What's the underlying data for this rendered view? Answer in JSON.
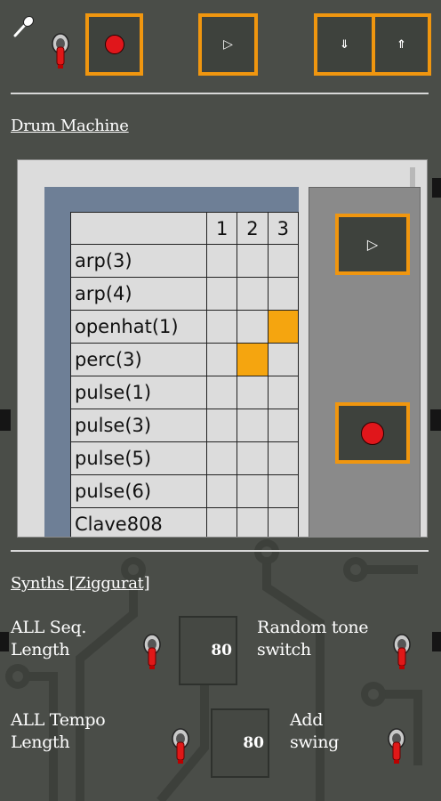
{
  "toolbar": {
    "icons": [
      "mic-icon",
      "toggle-switch-icon",
      "record-icon",
      "play-icon",
      "arrow-down-icon",
      "arrow-up-icon"
    ],
    "play_glyph": "▷",
    "down_glyph": "⇓",
    "up_glyph": "⇑"
  },
  "drum_machine": {
    "title": "Drum Machine",
    "columns": [
      "1",
      "2",
      "3"
    ],
    "rows": [
      {
        "name": "arp(3)",
        "steps": [
          false,
          false,
          false
        ]
      },
      {
        "name": "arp(4)",
        "steps": [
          false,
          false,
          false
        ]
      },
      {
        "name": "openhat(1)",
        "steps": [
          false,
          false,
          true
        ]
      },
      {
        "name": "perc(3)",
        "steps": [
          false,
          true,
          false
        ]
      },
      {
        "name": "pulse(1)",
        "steps": [
          false,
          false,
          false
        ]
      },
      {
        "name": "pulse(3)",
        "steps": [
          false,
          false,
          false
        ]
      },
      {
        "name": "pulse(5)",
        "steps": [
          false,
          false,
          false
        ]
      },
      {
        "name": "pulse(6)",
        "steps": [
          false,
          false,
          false
        ]
      },
      {
        "name": "Clave808",
        "steps": [
          false,
          false,
          false
        ]
      }
    ],
    "play_glyph": "▷"
  },
  "synths": {
    "title": "Synths [Ziggurat]",
    "seq_length_label": "ALL Seq. Length",
    "seq_length_value": "80",
    "random_tone_label": "Random tone switch",
    "tempo_length_label": "ALL Tempo Length",
    "tempo_length_value": "80",
    "add_swing_label": "Add swing"
  },
  "colors": {
    "background": "#4a4d48",
    "accent_orange": "#f0960f",
    "record_red": "#e0161b",
    "step_on": "#f5a50f",
    "table_frame": "#6e7f96"
  }
}
